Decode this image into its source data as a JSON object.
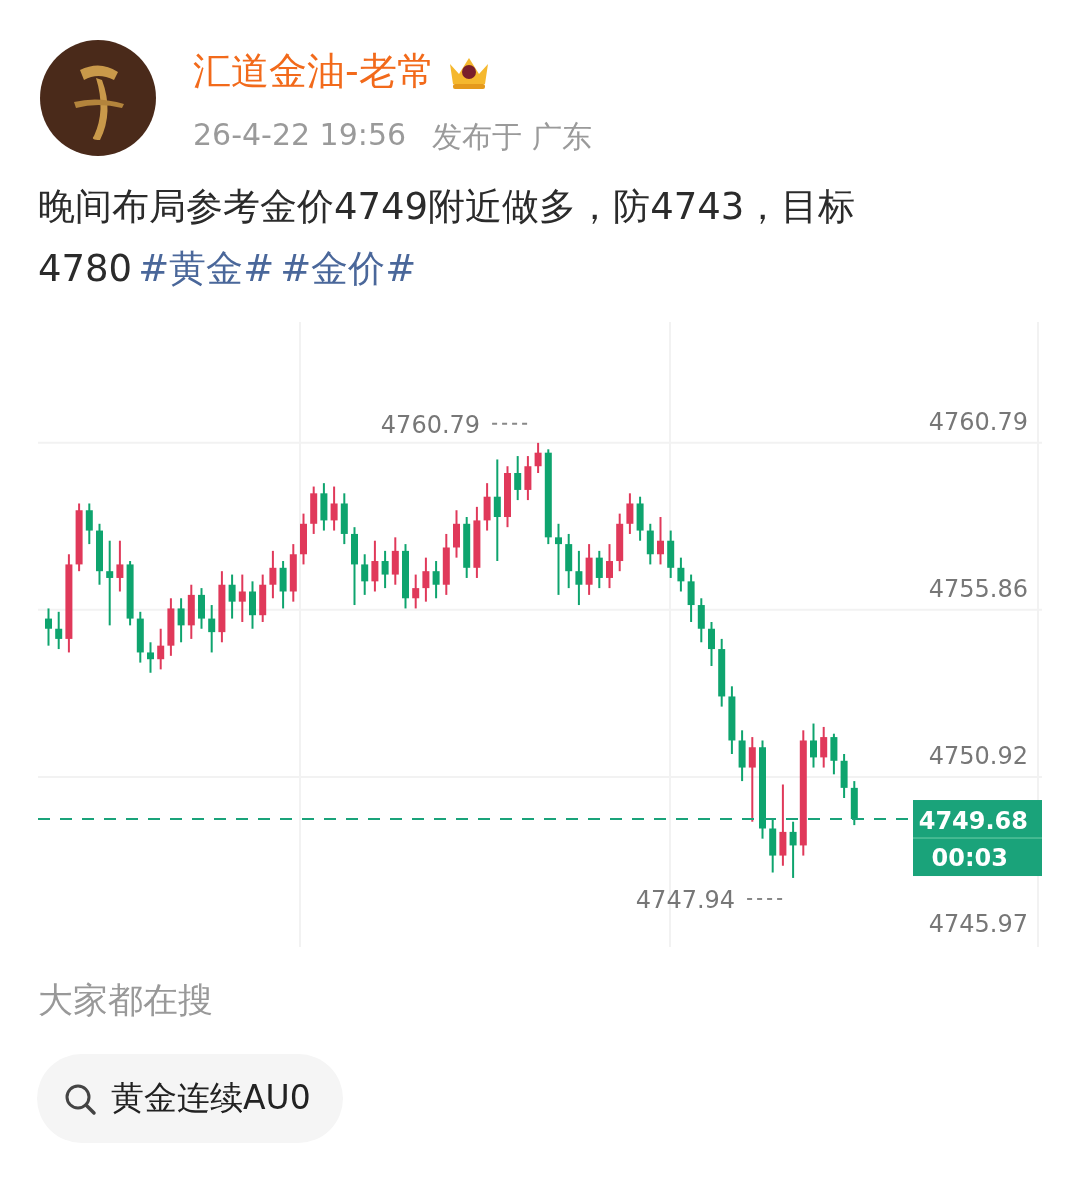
{
  "author": {
    "name": "汇道金油-老常",
    "time": "26-4-22 19:56",
    "location": "发布于 广东"
  },
  "post": {
    "text": "晚间布局参考金价4749附近做多，防4743，目标4780",
    "topics": [
      "#黄金#",
      "#金价#"
    ]
  },
  "chart": {
    "countdown": "00:03",
    "chart_data": {
      "type": "candlestick",
      "grid": true,
      "ylim": [
        4745.9,
        4764.36
      ],
      "ref_lines": [
        {
          "axis": "y",
          "value": 4749.68,
          "label": "4749.68",
          "color": "#1aa37a"
        }
      ],
      "ohlc": [
        [
          4755.6,
          4755.9,
          4754.8,
          4755.3
        ],
        [
          4755.3,
          4755.8,
          4754.7,
          4755.0
        ],
        [
          4755.0,
          4757.5,
          4754.6,
          4757.2
        ],
        [
          4757.2,
          4759.0,
          4757.0,
          4758.8
        ],
        [
          4758.8,
          4759.0,
          4757.8,
          4758.2
        ],
        [
          4758.2,
          4758.4,
          4756.6,
          4757.0
        ],
        [
          4757.0,
          4757.9,
          4755.4,
          4756.8
        ],
        [
          4756.8,
          4757.9,
          4756.4,
          4757.2
        ],
        [
          4757.2,
          4757.3,
          4755.4,
          4755.6
        ],
        [
          4755.6,
          4755.8,
          4754.3,
          4754.6
        ],
        [
          4754.6,
          4754.9,
          4754.0,
          4754.4
        ],
        [
          4754.4,
          4755.3,
          4754.1,
          4754.8
        ],
        [
          4754.8,
          4756.2,
          4754.5,
          4755.9
        ],
        [
          4755.9,
          4756.2,
          4754.9,
          4755.4
        ],
        [
          4755.4,
          4756.6,
          4755.0,
          4756.3
        ],
        [
          4756.3,
          4756.5,
          4755.3,
          4755.6
        ],
        [
          4755.6,
          4756.0,
          4754.6,
          4755.2
        ],
        [
          4755.2,
          4757.0,
          4754.9,
          4756.6
        ],
        [
          4756.6,
          4756.9,
          4755.6,
          4756.1
        ],
        [
          4756.1,
          4756.9,
          4755.5,
          4756.4
        ],
        [
          4756.4,
          4756.7,
          4755.3,
          4755.7
        ],
        [
          4755.7,
          4756.9,
          4755.5,
          4756.6
        ],
        [
          4756.6,
          4757.6,
          4756.2,
          4757.1
        ],
        [
          4757.1,
          4757.3,
          4755.9,
          4756.4
        ],
        [
          4756.4,
          4757.8,
          4756.1,
          4757.5
        ],
        [
          4757.5,
          4758.7,
          4757.2,
          4758.4
        ],
        [
          4758.4,
          4759.5,
          4758.1,
          4759.3
        ],
        [
          4759.3,
          4759.6,
          4758.2,
          4758.5
        ],
        [
          4758.5,
          4759.5,
          4758.2,
          4759.0
        ],
        [
          4759.0,
          4759.3,
          4757.8,
          4758.1
        ],
        [
          4758.1,
          4758.3,
          4756.0,
          4757.2
        ],
        [
          4757.2,
          4757.5,
          4756.3,
          4756.7
        ],
        [
          4756.7,
          4757.9,
          4756.4,
          4757.3
        ],
        [
          4757.3,
          4757.6,
          4756.5,
          4756.9
        ],
        [
          4756.9,
          4758.0,
          4756.6,
          4757.6
        ],
        [
          4757.6,
          4757.8,
          4755.9,
          4756.2
        ],
        [
          4756.2,
          4756.9,
          4755.9,
          4756.5
        ],
        [
          4756.5,
          4757.4,
          4756.1,
          4757.0
        ],
        [
          4757.0,
          4757.3,
          4756.2,
          4756.6
        ],
        [
          4756.6,
          4758.1,
          4756.3,
          4757.7
        ],
        [
          4757.7,
          4758.8,
          4757.4,
          4758.4
        ],
        [
          4758.4,
          4758.6,
          4756.8,
          4757.1
        ],
        [
          4757.1,
          4758.9,
          4756.8,
          4758.5
        ],
        [
          4758.5,
          4759.6,
          4758.2,
          4759.2
        ],
        [
          4759.2,
          4760.3,
          4757.3,
          4758.6
        ],
        [
          4758.6,
          4760.1,
          4758.3,
          4759.9
        ],
        [
          4759.9,
          4760.4,
          4759.1,
          4759.4
        ],
        [
          4759.4,
          4760.4,
          4759.1,
          4760.1
        ],
        [
          4760.1,
          4760.79,
          4759.9,
          4760.5
        ],
        [
          4760.5,
          4760.6,
          4757.8,
          4758.0
        ],
        [
          4758.0,
          4758.4,
          4756.3,
          4757.8
        ],
        [
          4757.8,
          4758.1,
          4756.5,
          4757.0
        ],
        [
          4757.0,
          4757.6,
          4756.0,
          4756.6
        ],
        [
          4756.6,
          4757.8,
          4756.3,
          4757.4
        ],
        [
          4757.4,
          4757.6,
          4756.5,
          4756.8
        ],
        [
          4756.8,
          4757.8,
          4756.5,
          4757.3
        ],
        [
          4757.3,
          4758.7,
          4757.0,
          4758.4
        ],
        [
          4758.4,
          4759.3,
          4758.1,
          4759.0
        ],
        [
          4759.0,
          4759.2,
          4757.9,
          4758.2
        ],
        [
          4758.2,
          4758.4,
          4757.2,
          4757.5
        ],
        [
          4757.5,
          4758.6,
          4757.2,
          4757.9
        ],
        [
          4757.9,
          4758.2,
          4756.8,
          4757.1
        ],
        [
          4757.1,
          4757.4,
          4756.4,
          4756.7
        ],
        [
          4756.7,
          4756.9,
          4755.5,
          4756.0
        ],
        [
          4756.0,
          4756.2,
          4754.9,
          4755.3
        ],
        [
          4755.3,
          4755.5,
          4754.2,
          4754.7
        ],
        [
          4754.7,
          4755.0,
          4753.0,
          4753.3
        ],
        [
          4753.3,
          4753.6,
          4751.6,
          4752.0
        ],
        [
          4752.0,
          4752.3,
          4750.8,
          4751.2
        ],
        [
          4751.2,
          4752.1,
          4749.6,
          4751.8
        ],
        [
          4751.8,
          4752.0,
          4749.1,
          4749.4
        ],
        [
          4749.4,
          4749.7,
          4748.1,
          4748.6
        ],
        [
          4748.6,
          4750.7,
          4748.3,
          4749.3
        ],
        [
          4749.3,
          4749.6,
          4747.94,
          4748.9
        ],
        [
          4748.9,
          4752.3,
          4748.6,
          4752.0
        ],
        [
          4752.0,
          4752.5,
          4751.2,
          4751.5
        ],
        [
          4751.5,
          4752.4,
          4751.2,
          4752.1
        ],
        [
          4752.1,
          4752.2,
          4751.0,
          4751.4
        ],
        [
          4751.4,
          4751.6,
          4750.3,
          4750.6
        ],
        [
          4750.6,
          4750.8,
          4749.5,
          4749.68
        ]
      ],
      "yticks": [
        {
          "value": 4760.79,
          "label": "4760.79"
        },
        {
          "value": 4755.86,
          "label": "4755.86"
        },
        {
          "value": 4750.92,
          "label": "4750.92"
        },
        {
          "value": 4745.97,
          "label": "4745.97"
        }
      ],
      "annotations": [
        "4760.79",
        "4747.94"
      ]
    }
  },
  "trending": {
    "title": "大家都在搜",
    "items": [
      "黄金连续AU0"
    ]
  }
}
